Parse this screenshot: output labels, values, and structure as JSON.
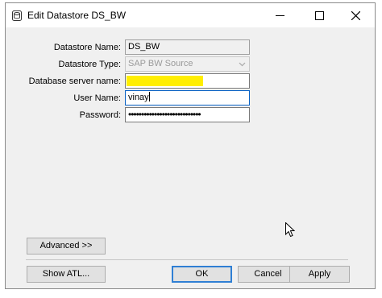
{
  "window": {
    "title": "Edit Datastore DS_BW",
    "icon": "datastore-icon"
  },
  "form": {
    "datastore_name_label": "Datastore Name:",
    "datastore_name_value": "DS_BW",
    "datastore_type_label": "Datastore Type:",
    "datastore_type_value": "SAP BW Source",
    "db_server_label": "Database server name:",
    "db_server_value": "",
    "user_name_label": "User Name:",
    "user_name_value": "vinay",
    "password_label": "Password:",
    "password_value": "••••••••••••••••••••••••••••"
  },
  "buttons": {
    "advanced": "Advanced >>",
    "show_atl": "Show ATL...",
    "ok": "OK",
    "cancel": "Cancel",
    "apply": "Apply"
  },
  "colors": {
    "redaction_highlight": "#ffee00",
    "focus_border": "#0a62c4"
  }
}
